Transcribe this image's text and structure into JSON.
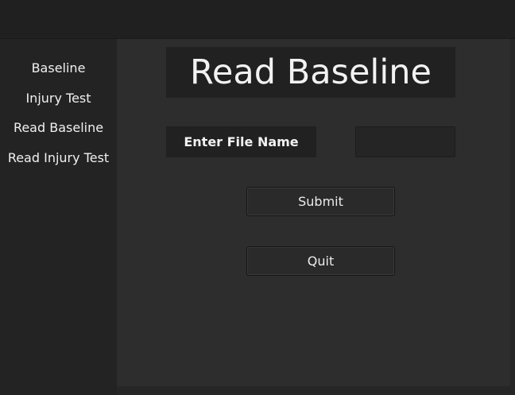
{
  "sidebar": {
    "items": [
      {
        "label": "Baseline"
      },
      {
        "label": "Injury Test"
      },
      {
        "label": "Read Baseline"
      },
      {
        "label": "Read Injury Test"
      }
    ]
  },
  "main": {
    "title": "Read Baseline",
    "file_label": "Enter File Name",
    "file_input_value": "",
    "submit_label": "Submit",
    "quit_label": "Quit"
  },
  "colors": {
    "window_bg": "#262626",
    "topbar_bg": "#202020",
    "sidebar_bg": "#232323",
    "main_bg": "#2d2d2d",
    "label_bg": "#212121",
    "text": "#f0f0f0"
  }
}
